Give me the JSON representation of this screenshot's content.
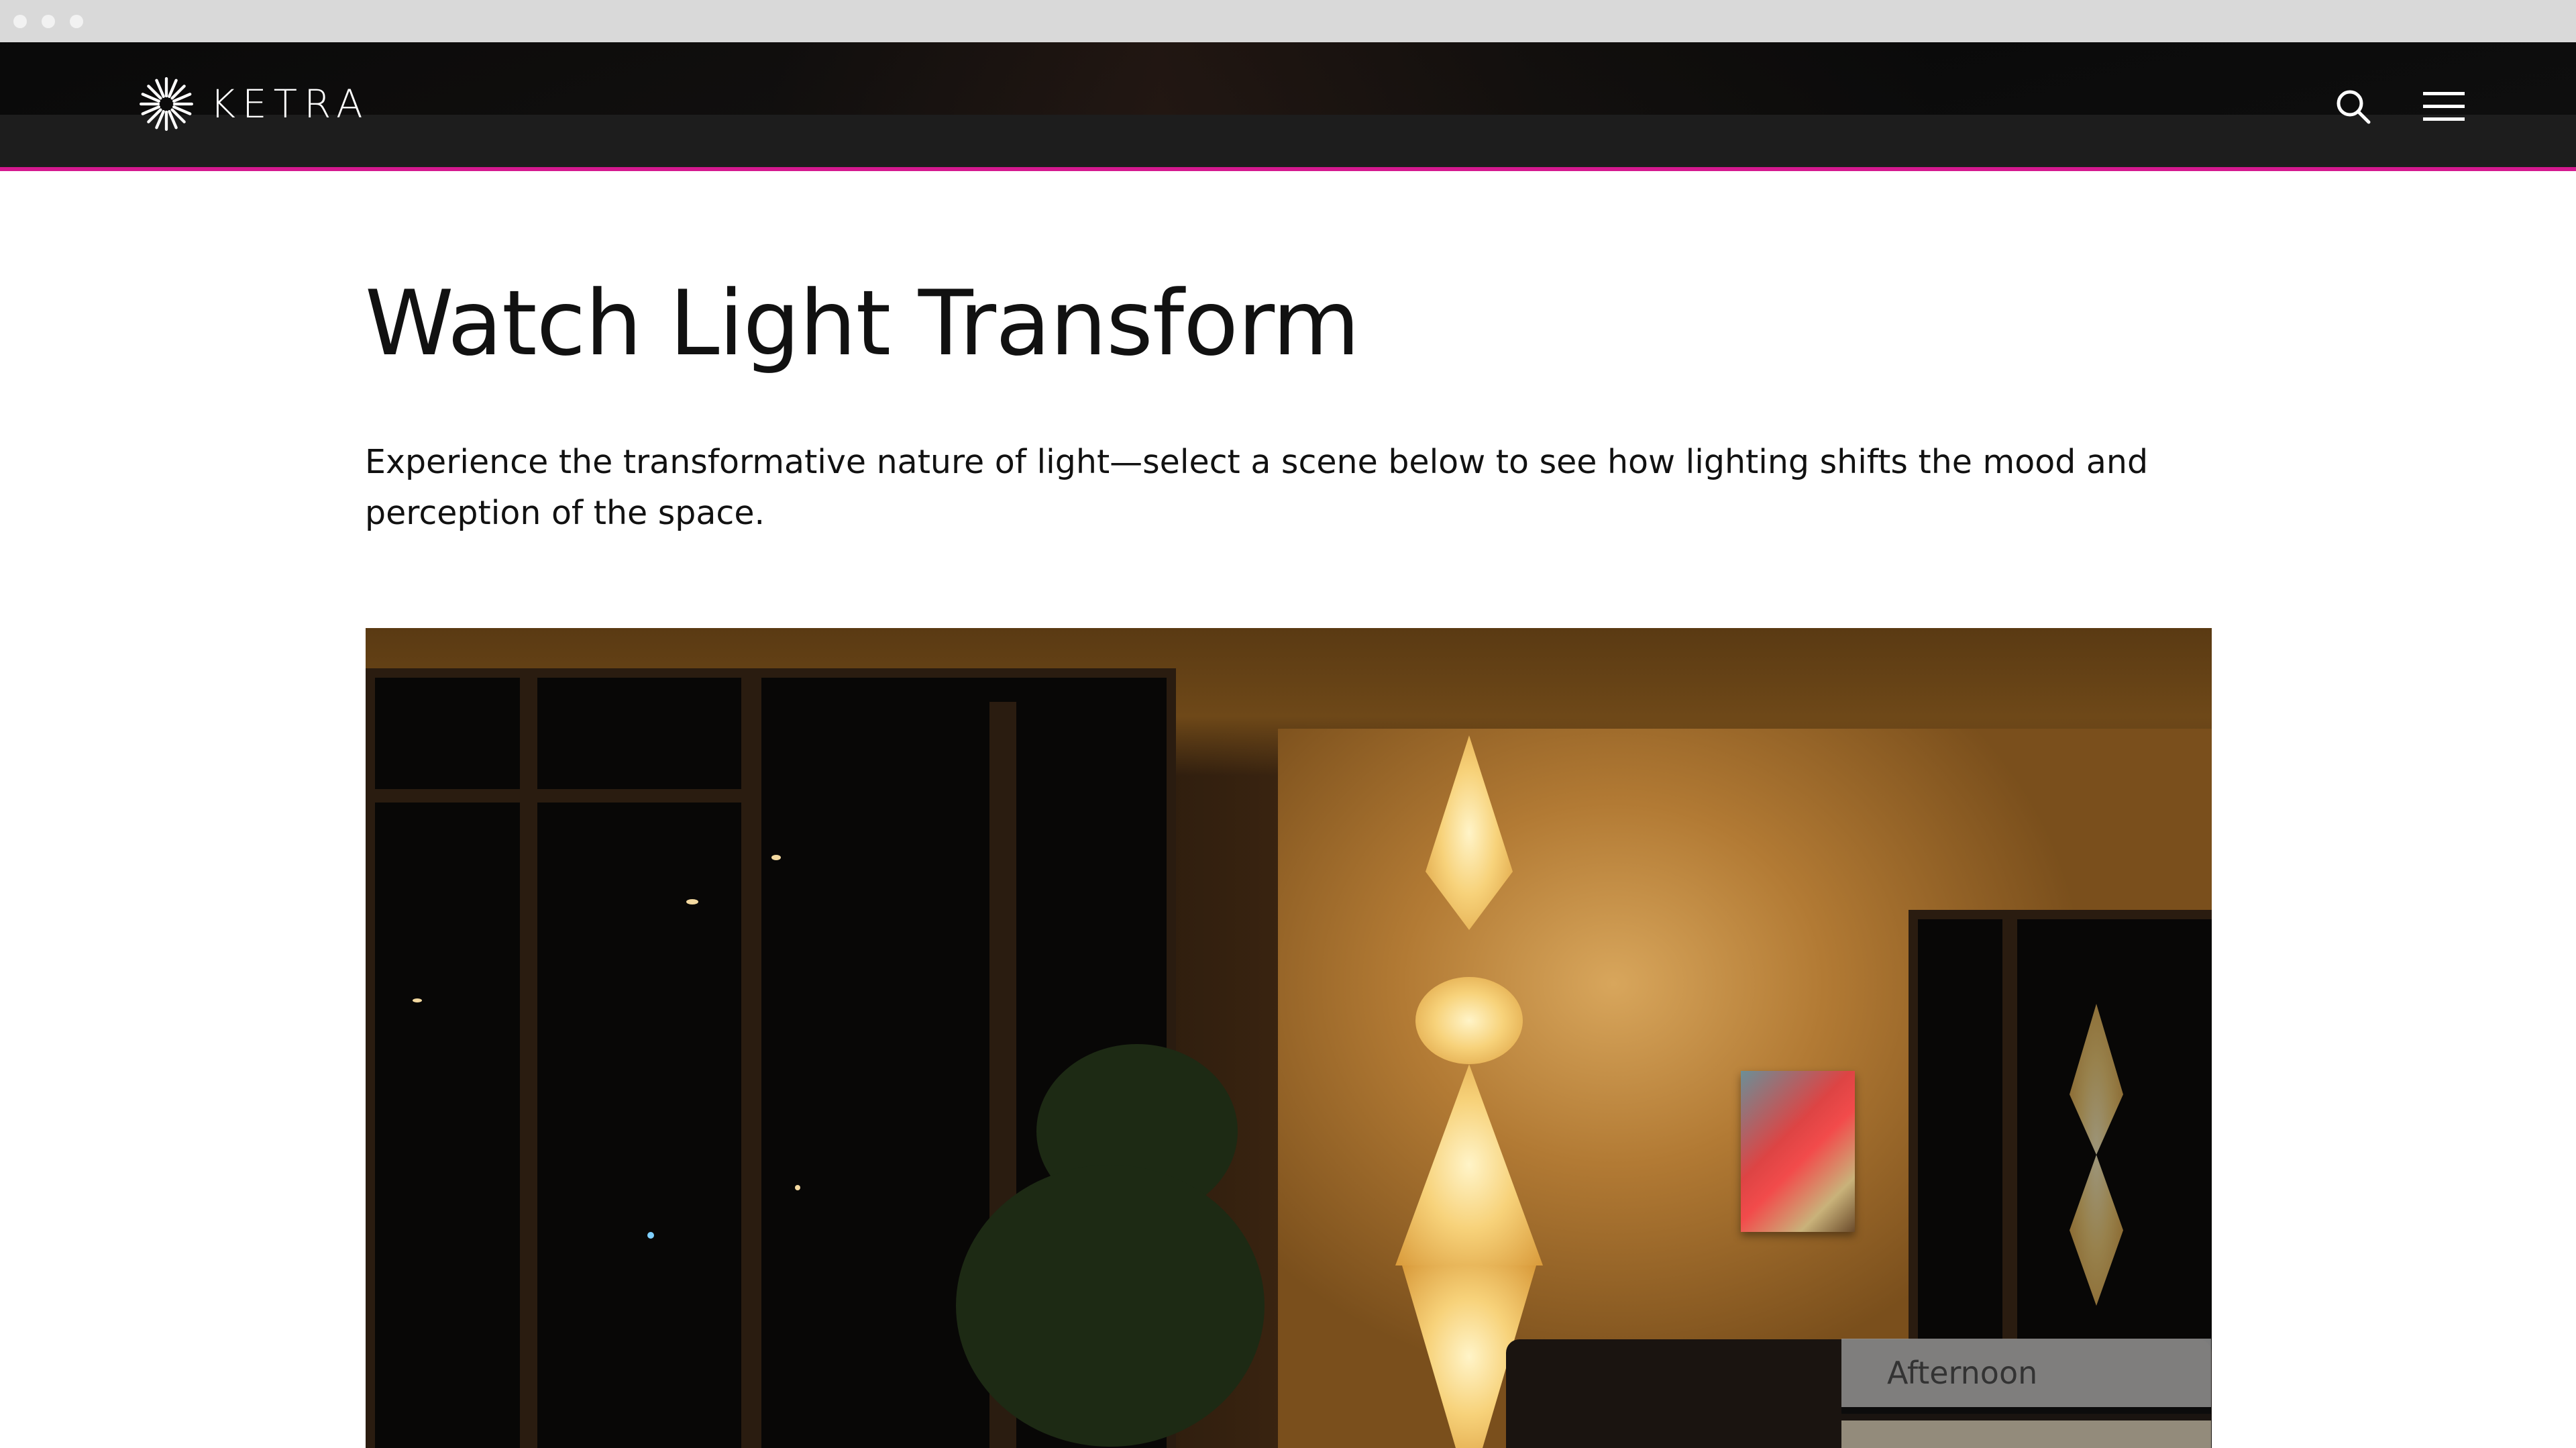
{
  "brand": {
    "name": "KETRA",
    "accent_color": "#d4198f"
  },
  "header": {
    "search_icon": "search-icon",
    "menu_icon": "hamburger-menu-icon"
  },
  "main": {
    "title": "Watch Light Transform",
    "intro": "Experience the transformative nature of light—select a scene below to see how lighting shifts the mood and perception of the space."
  },
  "scene_viewer": {
    "image_alt": "Living room at night lit by a tall paper lantern floor lamp",
    "tabs": [
      {
        "label": "Afternoon"
      },
      {
        "label": ""
      }
    ]
  }
}
